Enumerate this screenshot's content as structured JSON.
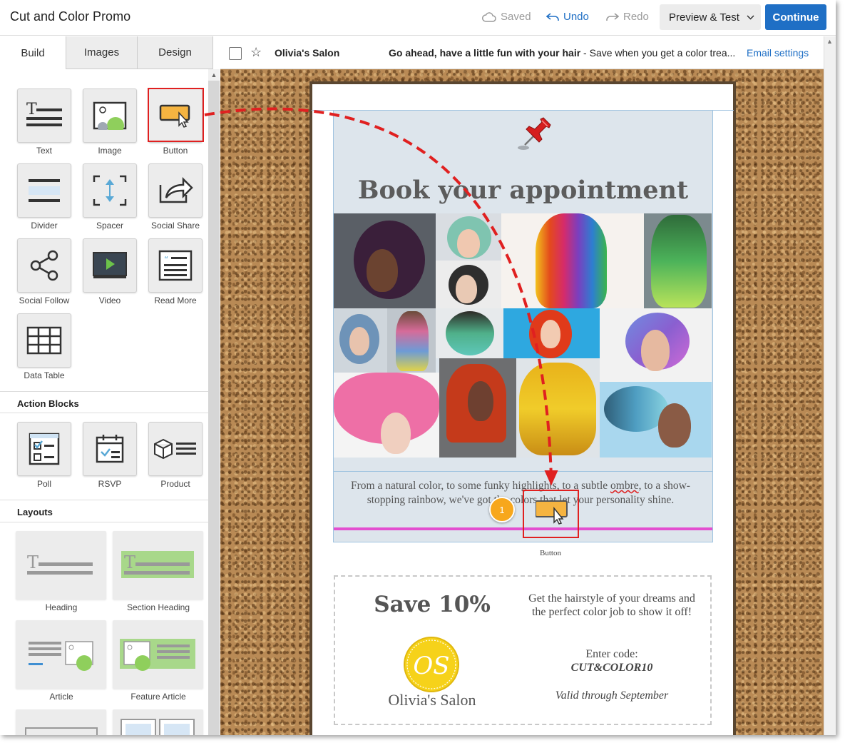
{
  "topbar": {
    "title": "Cut and Color Promo",
    "saved_label": "Saved",
    "undo_label": "Undo",
    "redo_label": "Redo",
    "preview_label": "Preview & Test",
    "continue_label": "Continue",
    "accent_color": "#1f6fc5"
  },
  "sidebar": {
    "tabs": [
      {
        "label": "Build",
        "active": true
      },
      {
        "label": "Images",
        "active": false
      },
      {
        "label": "Design",
        "active": false
      }
    ],
    "blocks": [
      {
        "label": "Text",
        "icon": "text-icon"
      },
      {
        "label": "Image",
        "icon": "image-icon"
      },
      {
        "label": "Button",
        "icon": "button-icon",
        "highlighted": true
      },
      {
        "label": "Divider",
        "icon": "divider-icon"
      },
      {
        "label": "Spacer",
        "icon": "spacer-icon"
      },
      {
        "label": "Social Share",
        "icon": "social-share-icon"
      },
      {
        "label": "Social Follow",
        "icon": "social-follow-icon"
      },
      {
        "label": "Video",
        "icon": "video-icon"
      },
      {
        "label": "Read More",
        "icon": "read-more-icon"
      },
      {
        "label": "Data Table",
        "icon": "data-table-icon"
      }
    ],
    "action_blocks_heading": "Action Blocks",
    "action_blocks": [
      {
        "label": "Poll",
        "icon": "poll-icon"
      },
      {
        "label": "RSVP",
        "icon": "rsvp-icon"
      },
      {
        "label": "Product",
        "icon": "product-icon"
      }
    ],
    "layouts_heading": "Layouts",
    "layouts": [
      {
        "label": "Heading"
      },
      {
        "label": "Section Heading"
      },
      {
        "label": "Article"
      },
      {
        "label": "Feature Article"
      }
    ]
  },
  "email_header": {
    "from_name": "Olivia's Salon",
    "subject_bold": "Go ahead, have a little fun with your hair",
    "subject_rest": " - Save when you get a color trea...",
    "settings_link": "Email settings"
  },
  "email": {
    "hero_title": "Book your appointment",
    "hero_text_1": "From a natural color, to some funky highlights, to a subtle ",
    "hero_text_misspelled": "ombre",
    "hero_text_2": ", to a show-stopping rainbow, we've got the colors that let your personality shine.",
    "drop_step": "1",
    "drop_label": "Button",
    "coupon": {
      "heading": "Save 10%",
      "logo_monogram": "OS",
      "salon_name": "Olivia's Salon",
      "body": "Get the hairstyle of your dreams and the perfect color job to show it off!",
      "code_label": "Enter code:",
      "code": "CUT&COLOR10",
      "valid": "Valid through September"
    }
  },
  "colors": {
    "highlight": "#e02020",
    "badge": "#f7a71c",
    "divider_pink": "#e34fd0",
    "cork": "#b98a55"
  }
}
